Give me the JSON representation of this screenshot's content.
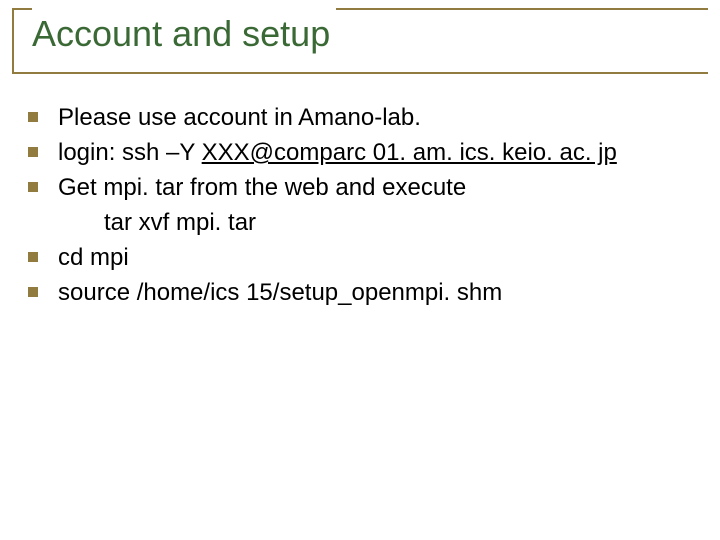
{
  "title": "Account and setup",
  "bullets": {
    "b1": "Please use account in Amano-lab.",
    "b2_prefix": "login: ssh –Y ",
    "b2_link": "XXX@comparc 01. am. ics. keio. ac. jp",
    "b3": "Get mpi. tar from the web and execute",
    "b3_sub": "tar xvf mpi. tar",
    "b4": "cd mpi",
    "b5": "source /home/ics 15/setup_openmpi. shm"
  }
}
